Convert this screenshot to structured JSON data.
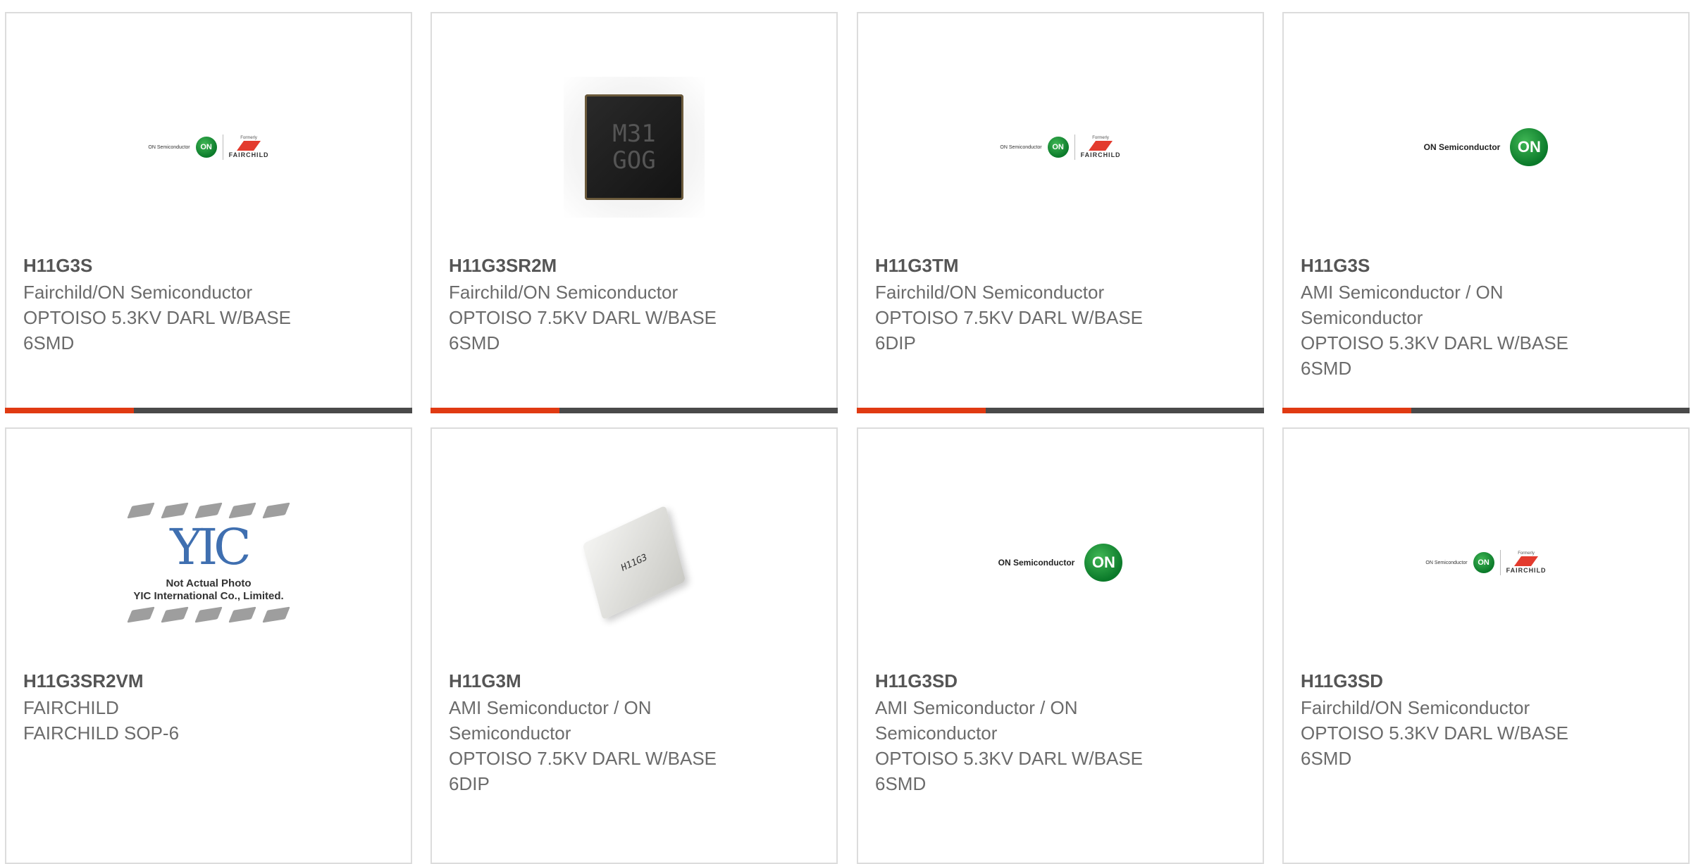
{
  "theme": {
    "accent": "#e03a12",
    "bar": "#4a4a4a",
    "border": "#dcdcdc"
  },
  "logos": {
    "on_semi_small": "ON Semiconductor",
    "on_mark": "ON",
    "formerly": "Formerly",
    "fairchild": "FAIRCHILD",
    "on_semi_large": "ON Semiconductor"
  },
  "chip_marking": [
    "M31",
    "GOG"
  ],
  "dip_marking": "H11G3",
  "not_actual_photo": {
    "logo": "YIC",
    "caption_line1": "Not Actual Photo",
    "caption_line2": "YIC International Co., Limited."
  },
  "products": [
    {
      "part_number": "H11G3S",
      "manufacturer": "Fairchild/ON Semiconductor",
      "description_1": "OPTOISO 5.3KV DARL W/BASE",
      "description_2": "6SMD",
      "image": "on-fairchild-logo"
    },
    {
      "part_number": "H11G3SR2M",
      "manufacturer": "Fairchild/ON Semiconductor",
      "description_1": "OPTOISO 7.5KV DARL W/BASE",
      "description_2": "6SMD",
      "image": "smd-chip"
    },
    {
      "part_number": "H11G3TM",
      "manufacturer": "Fairchild/ON Semiconductor",
      "description_1": "OPTOISO 7.5KV DARL W/BASE",
      "description_2": "6DIP",
      "image": "on-fairchild-logo"
    },
    {
      "part_number": "H11G3S",
      "manufacturer_1": "AMI Semiconductor / ON",
      "manufacturer_2": "Semiconductor",
      "description_1": "OPTOISO 5.3KV DARL W/BASE",
      "description_2": "6SMD",
      "image": "on-semi-logo"
    },
    {
      "part_number": "H11G3SR2VM",
      "manufacturer": "FAIRCHILD",
      "description_1": "FAIRCHILD SOP-6",
      "image": "not-actual-photo"
    },
    {
      "part_number": "H11G3M",
      "manufacturer_1": "AMI Semiconductor / ON",
      "manufacturer_2": "Semiconductor",
      "description_1": "OPTOISO 7.5KV DARL W/BASE",
      "description_2": "6DIP",
      "image": "dip-chip"
    },
    {
      "part_number": "H11G3SD",
      "manufacturer_1": "AMI Semiconductor / ON",
      "manufacturer_2": "Semiconductor",
      "description_1": "OPTOISO 5.3KV DARL W/BASE",
      "description_2": "6SMD",
      "image": "on-semi-logo"
    },
    {
      "part_number": "H11G3SD",
      "manufacturer": "Fairchild/ON Semiconductor",
      "description_1": "OPTOISO 5.3KV DARL W/BASE",
      "description_2": "6SMD",
      "image": "on-fairchild-logo"
    }
  ]
}
